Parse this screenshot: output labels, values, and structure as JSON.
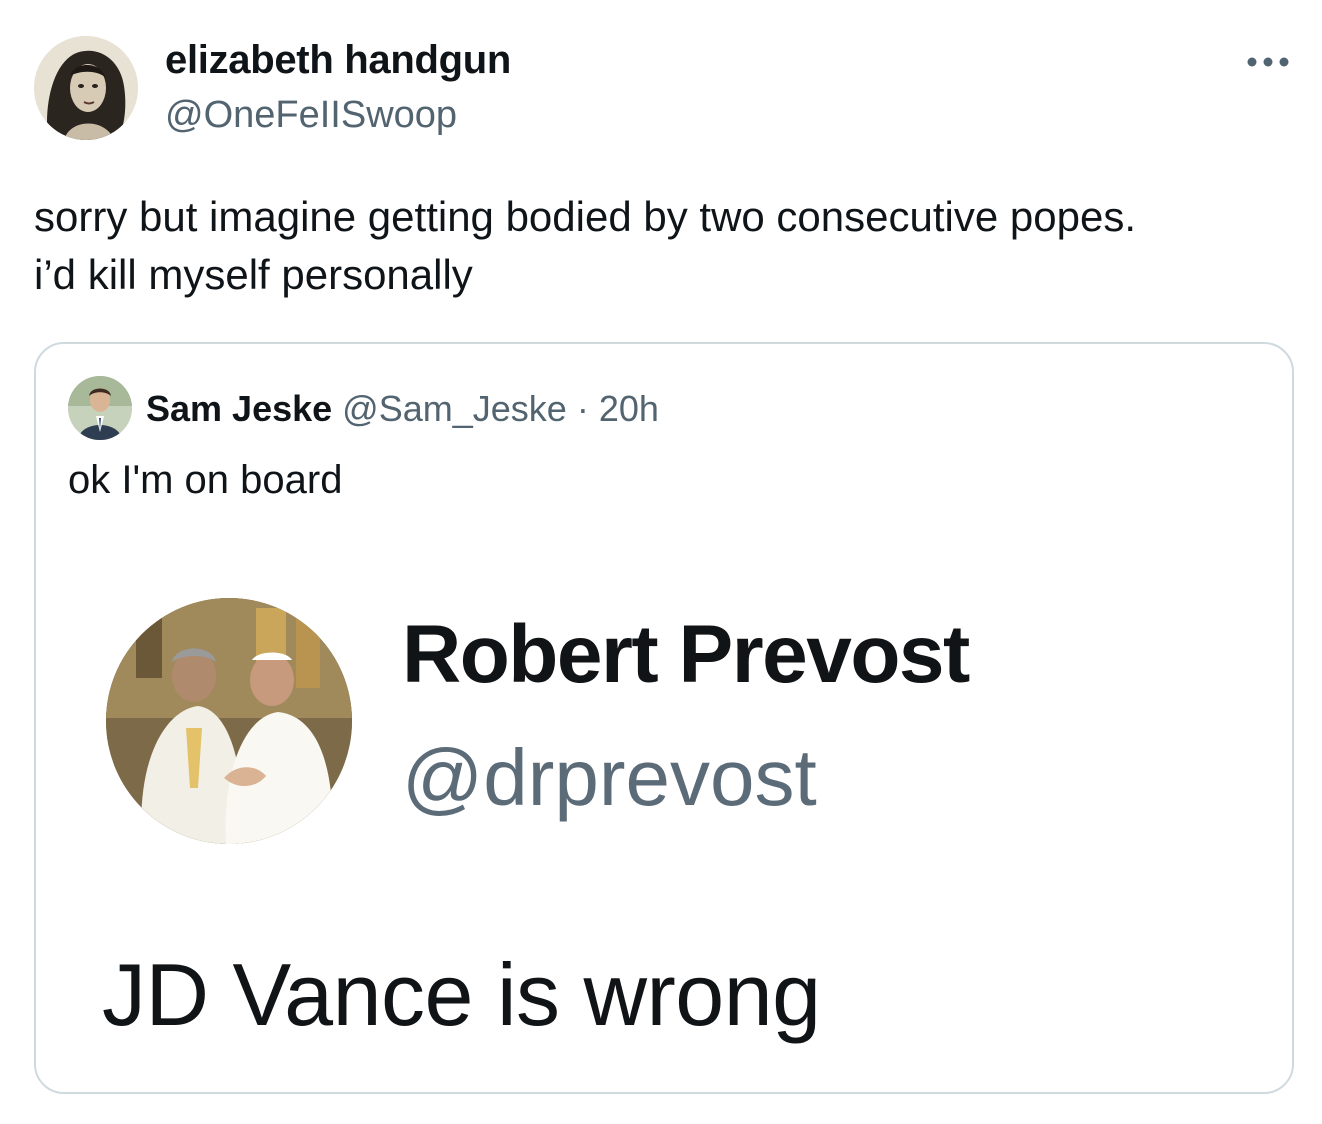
{
  "tweet": {
    "author": {
      "display_name": "elizabeth handgun",
      "handle": "@OneFeIISwoop",
      "avatar_icon": "profile-photo"
    },
    "more_icon": "more-options-icon",
    "text_lines": [
      "sorry but imagine getting bodied by two consecutive popes.",
      "i’d kill myself personally"
    ]
  },
  "quote": {
    "author": {
      "display_name": "Sam Jeske",
      "handle": "@Sam_Jeske",
      "separator": "·",
      "time": "20h",
      "avatar_icon": "profile-photo"
    },
    "text": "ok I'm on board",
    "media": {
      "name": "Robert Prevost",
      "handle": "@drprevost",
      "text": "JD Vance is wrong",
      "avatar_icon": "profile-photo"
    }
  },
  "colors": {
    "primary_text": "#0f1419",
    "secondary_text": "#536471",
    "border": "#cfd9de",
    "background": "#ffffff"
  }
}
